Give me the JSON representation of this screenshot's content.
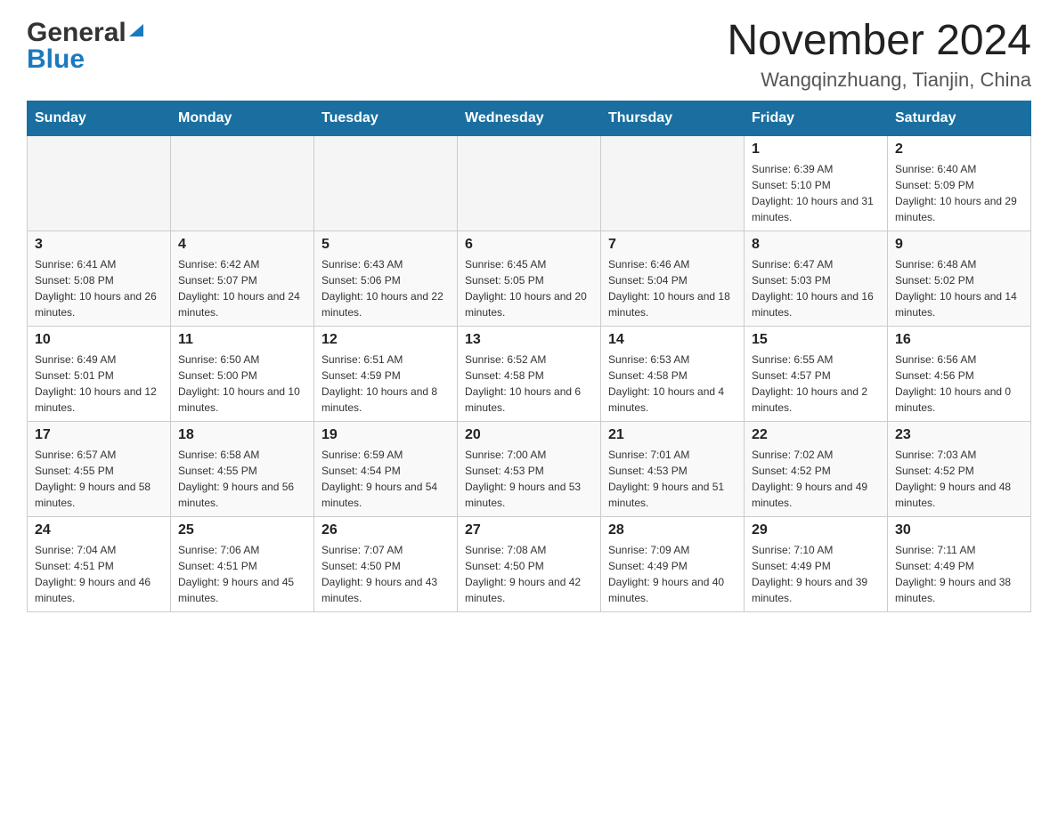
{
  "header": {
    "logo_general": "General",
    "logo_blue": "Blue",
    "month_year": "November 2024",
    "location": "Wangqinzhuang, Tianjin, China"
  },
  "days_of_week": [
    "Sunday",
    "Monday",
    "Tuesday",
    "Wednesday",
    "Thursday",
    "Friday",
    "Saturday"
  ],
  "weeks": [
    [
      {
        "day": "",
        "info": ""
      },
      {
        "day": "",
        "info": ""
      },
      {
        "day": "",
        "info": ""
      },
      {
        "day": "",
        "info": ""
      },
      {
        "day": "",
        "info": ""
      },
      {
        "day": "1",
        "info": "Sunrise: 6:39 AM\nSunset: 5:10 PM\nDaylight: 10 hours and 31 minutes."
      },
      {
        "day": "2",
        "info": "Sunrise: 6:40 AM\nSunset: 5:09 PM\nDaylight: 10 hours and 29 minutes."
      }
    ],
    [
      {
        "day": "3",
        "info": "Sunrise: 6:41 AM\nSunset: 5:08 PM\nDaylight: 10 hours and 26 minutes."
      },
      {
        "day": "4",
        "info": "Sunrise: 6:42 AM\nSunset: 5:07 PM\nDaylight: 10 hours and 24 minutes."
      },
      {
        "day": "5",
        "info": "Sunrise: 6:43 AM\nSunset: 5:06 PM\nDaylight: 10 hours and 22 minutes."
      },
      {
        "day": "6",
        "info": "Sunrise: 6:45 AM\nSunset: 5:05 PM\nDaylight: 10 hours and 20 minutes."
      },
      {
        "day": "7",
        "info": "Sunrise: 6:46 AM\nSunset: 5:04 PM\nDaylight: 10 hours and 18 minutes."
      },
      {
        "day": "8",
        "info": "Sunrise: 6:47 AM\nSunset: 5:03 PM\nDaylight: 10 hours and 16 minutes."
      },
      {
        "day": "9",
        "info": "Sunrise: 6:48 AM\nSunset: 5:02 PM\nDaylight: 10 hours and 14 minutes."
      }
    ],
    [
      {
        "day": "10",
        "info": "Sunrise: 6:49 AM\nSunset: 5:01 PM\nDaylight: 10 hours and 12 minutes."
      },
      {
        "day": "11",
        "info": "Sunrise: 6:50 AM\nSunset: 5:00 PM\nDaylight: 10 hours and 10 minutes."
      },
      {
        "day": "12",
        "info": "Sunrise: 6:51 AM\nSunset: 4:59 PM\nDaylight: 10 hours and 8 minutes."
      },
      {
        "day": "13",
        "info": "Sunrise: 6:52 AM\nSunset: 4:58 PM\nDaylight: 10 hours and 6 minutes."
      },
      {
        "day": "14",
        "info": "Sunrise: 6:53 AM\nSunset: 4:58 PM\nDaylight: 10 hours and 4 minutes."
      },
      {
        "day": "15",
        "info": "Sunrise: 6:55 AM\nSunset: 4:57 PM\nDaylight: 10 hours and 2 minutes."
      },
      {
        "day": "16",
        "info": "Sunrise: 6:56 AM\nSunset: 4:56 PM\nDaylight: 10 hours and 0 minutes."
      }
    ],
    [
      {
        "day": "17",
        "info": "Sunrise: 6:57 AM\nSunset: 4:55 PM\nDaylight: 9 hours and 58 minutes."
      },
      {
        "day": "18",
        "info": "Sunrise: 6:58 AM\nSunset: 4:55 PM\nDaylight: 9 hours and 56 minutes."
      },
      {
        "day": "19",
        "info": "Sunrise: 6:59 AM\nSunset: 4:54 PM\nDaylight: 9 hours and 54 minutes."
      },
      {
        "day": "20",
        "info": "Sunrise: 7:00 AM\nSunset: 4:53 PM\nDaylight: 9 hours and 53 minutes."
      },
      {
        "day": "21",
        "info": "Sunrise: 7:01 AM\nSunset: 4:53 PM\nDaylight: 9 hours and 51 minutes."
      },
      {
        "day": "22",
        "info": "Sunrise: 7:02 AM\nSunset: 4:52 PM\nDaylight: 9 hours and 49 minutes."
      },
      {
        "day": "23",
        "info": "Sunrise: 7:03 AM\nSunset: 4:52 PM\nDaylight: 9 hours and 48 minutes."
      }
    ],
    [
      {
        "day": "24",
        "info": "Sunrise: 7:04 AM\nSunset: 4:51 PM\nDaylight: 9 hours and 46 minutes."
      },
      {
        "day": "25",
        "info": "Sunrise: 7:06 AM\nSunset: 4:51 PM\nDaylight: 9 hours and 45 minutes."
      },
      {
        "day": "26",
        "info": "Sunrise: 7:07 AM\nSunset: 4:50 PM\nDaylight: 9 hours and 43 minutes."
      },
      {
        "day": "27",
        "info": "Sunrise: 7:08 AM\nSunset: 4:50 PM\nDaylight: 9 hours and 42 minutes."
      },
      {
        "day": "28",
        "info": "Sunrise: 7:09 AM\nSunset: 4:49 PM\nDaylight: 9 hours and 40 minutes."
      },
      {
        "day": "29",
        "info": "Sunrise: 7:10 AM\nSunset: 4:49 PM\nDaylight: 9 hours and 39 minutes."
      },
      {
        "day": "30",
        "info": "Sunrise: 7:11 AM\nSunset: 4:49 PM\nDaylight: 9 hours and 38 minutes."
      }
    ]
  ]
}
